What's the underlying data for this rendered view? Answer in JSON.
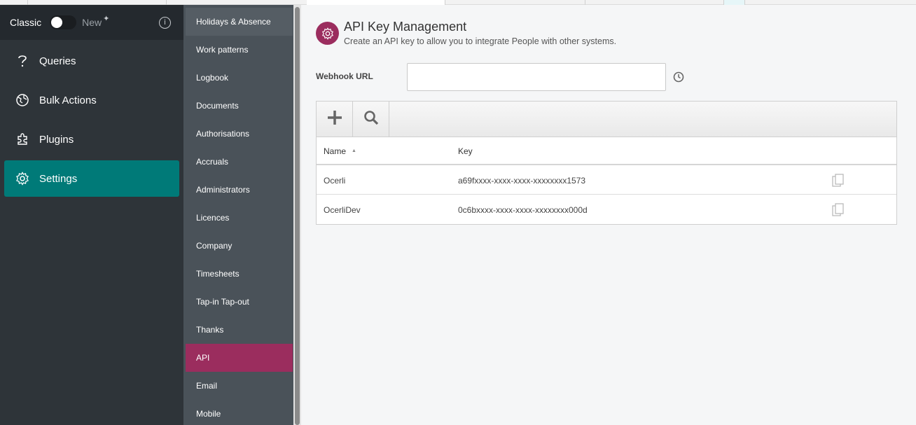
{
  "nav": {
    "classic_label": "Classic",
    "new_label": "New",
    "items": [
      {
        "label": "Queries",
        "icon": "question-icon"
      },
      {
        "label": "Bulk Actions",
        "icon": "globe-icon"
      },
      {
        "label": "Plugins",
        "icon": "puzzle-icon"
      },
      {
        "label": "Settings",
        "icon": "gear-icon",
        "active": true
      }
    ]
  },
  "subnav": {
    "items": [
      "Holidays & Absence",
      "Work patterns",
      "Logbook",
      "Documents",
      "Authorisations",
      "Accruals",
      "Administrators",
      "Licences",
      "Company",
      "Timesheets",
      "Tap-in Tap-out",
      "Thanks",
      "API",
      "Email",
      "Mobile"
    ],
    "active": "API"
  },
  "page": {
    "title": "API Key Management",
    "subtitle": "Create an API key to allow you to integrate People with other systems.",
    "webhook_label": "Webhook URL",
    "webhook_value": ""
  },
  "table": {
    "columns": [
      "Name",
      "Key"
    ],
    "rows": [
      {
        "name": "Ocerli",
        "key": "a69fxxxx-xxxx-xxxx-xxxxxxxx1573"
      },
      {
        "name": "OcerliDev",
        "key": "0c6bxxxx-xxxx-xxxx-xxxxxxxx000d"
      }
    ]
  },
  "colors": {
    "accent_teal": "#007a78",
    "accent_magenta": "#9b2d5e",
    "nav_dark": "#2e3439"
  }
}
